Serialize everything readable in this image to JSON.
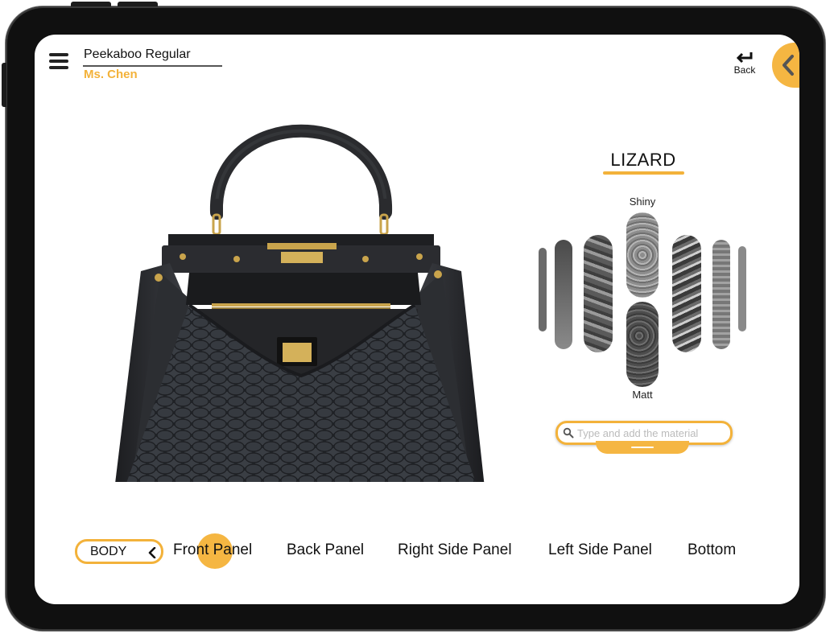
{
  "header": {
    "product_name": "Peekaboo Regular",
    "client_name": "Ms. Chen",
    "back_label": "Back"
  },
  "material_panel": {
    "title": "LIZARD",
    "shiny_label": "Shiny",
    "matt_label": "Matt",
    "search_placeholder": "Type and add the material"
  },
  "part_selector": {
    "category": "BODY",
    "parts": [
      "Front Panel",
      "Back Panel",
      "Right Side Panel",
      "Left Side Panel",
      "Bottom"
    ],
    "active_part": "Front Panel"
  },
  "colors": {
    "accent": "#f5b642",
    "text": "#111111",
    "device_frame": "#101010"
  },
  "icons": [
    "hamburger-menu-icon",
    "back-arrow-icon",
    "chevron-left-icon",
    "search-icon",
    "chevron-left-small-icon"
  ]
}
